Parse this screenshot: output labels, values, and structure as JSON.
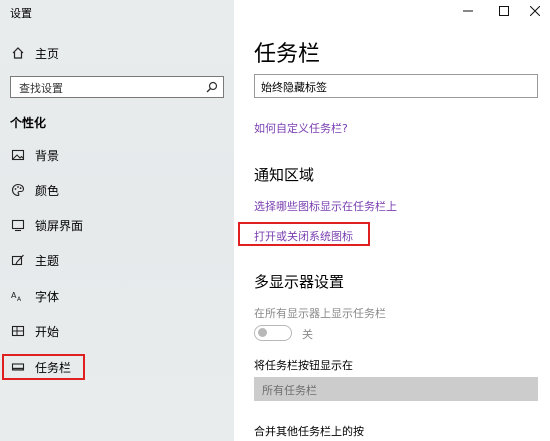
{
  "window": {
    "title": "设置"
  },
  "sidebar": {
    "home_label": "主页",
    "search_placeholder": "查找设置",
    "section_label": "个性化",
    "items": [
      {
        "label": "背景",
        "icon": "image-icon"
      },
      {
        "label": "颜色",
        "icon": "palette-icon"
      },
      {
        "label": "锁屏界面",
        "icon": "lock-screen-icon"
      },
      {
        "label": "主题",
        "icon": "theme-icon"
      },
      {
        "label": "字体",
        "icon": "font-icon"
      },
      {
        "label": "开始",
        "icon": "start-icon"
      },
      {
        "label": "任务栏",
        "icon": "taskbar-icon",
        "selected": true
      }
    ]
  },
  "main": {
    "title": "任务栏",
    "combine_value": "始终隐藏标签",
    "customize_link": "如何自定义任务栏?",
    "notification": {
      "heading": "通知区域",
      "link1": "选择哪些图标显示在任务栏上",
      "link2": "打开或关闭系统图标"
    },
    "multi_display": {
      "heading": "多显示器设置",
      "show_all_label": "在所有显示器上显示任务栏",
      "toggle_state": "关",
      "buttons_label": "将任务栏按钮显示在",
      "buttons_value": "所有任务栏",
      "combine_other_label": "合并其他任务栏上的按"
    }
  },
  "colors": {
    "accent_link": "#7a3fb0",
    "highlight": "#e02020"
  }
}
